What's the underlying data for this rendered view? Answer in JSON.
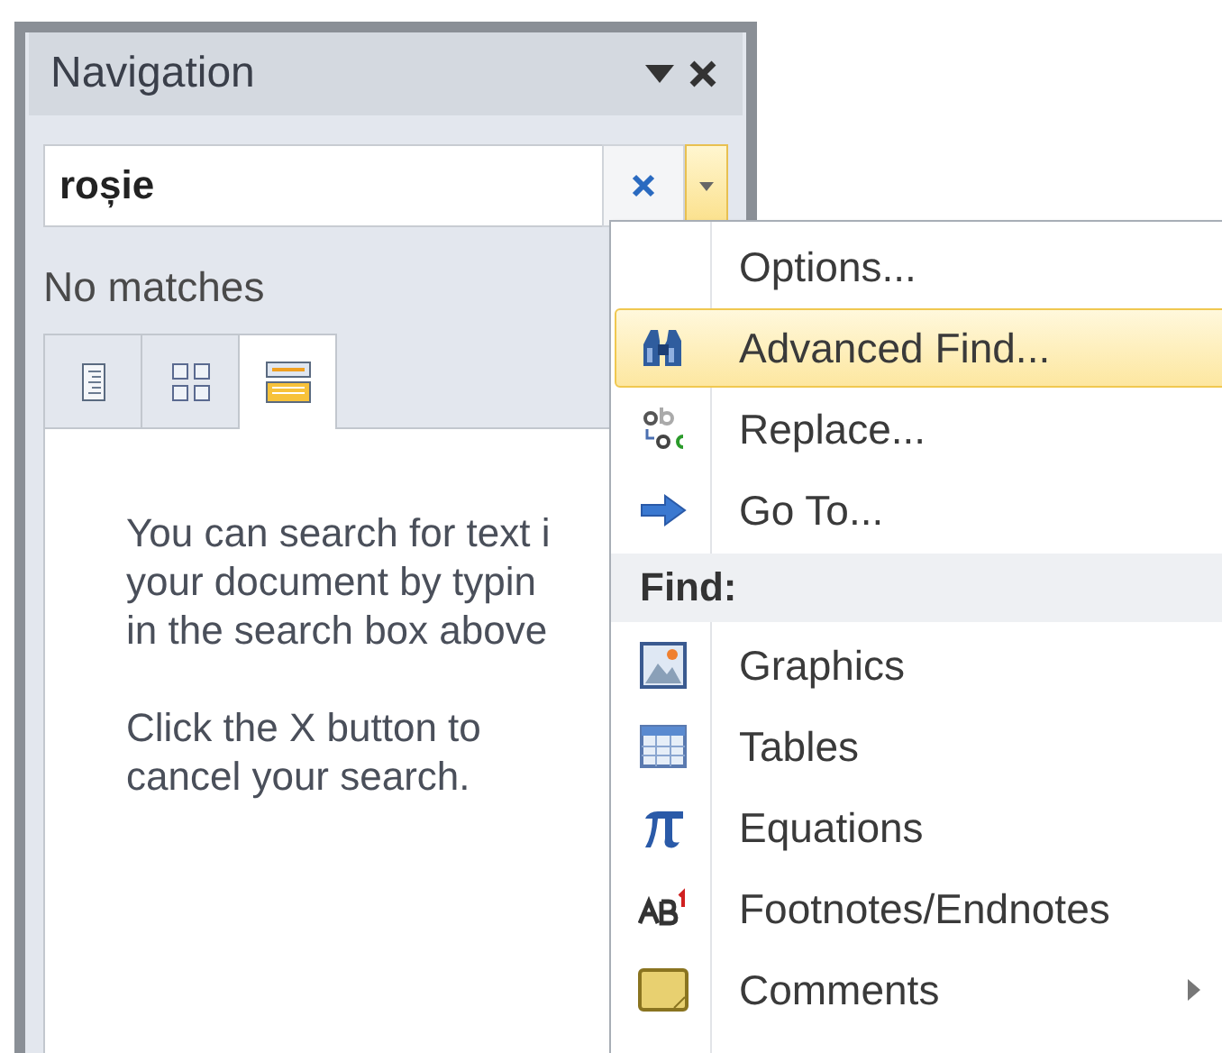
{
  "panel": {
    "title": "Navigation"
  },
  "search": {
    "value": "roșie"
  },
  "status": "No matches",
  "tabs": [
    {
      "selected": false
    },
    {
      "selected": false
    },
    {
      "selected": true
    }
  ],
  "help_paragraphs": [
    [
      "You can search for text i",
      "your document by typin",
      "in the search box above"
    ],
    [
      "Click the X button to",
      "cancel your search."
    ]
  ],
  "menu": [
    {
      "kind": "item",
      "label": "Options...",
      "selected": false,
      "submenu": false
    },
    {
      "kind": "item",
      "label": "Advanced Find...",
      "selected": true,
      "submenu": false
    },
    {
      "kind": "item",
      "label": "Replace...",
      "selected": false,
      "submenu": false
    },
    {
      "kind": "item",
      "label": "Go To...",
      "selected": false,
      "submenu": false
    },
    {
      "kind": "header",
      "label": "Find:"
    },
    {
      "kind": "item",
      "label": "Graphics",
      "selected": false,
      "submenu": false
    },
    {
      "kind": "item",
      "label": "Tables",
      "selected": false,
      "submenu": false
    },
    {
      "kind": "item",
      "label": "Equations",
      "selected": false,
      "submenu": false
    },
    {
      "kind": "item",
      "label": "Footnotes/Endnotes",
      "selected": false,
      "submenu": false
    },
    {
      "kind": "item",
      "label": "Comments",
      "selected": false,
      "submenu": true
    }
  ]
}
